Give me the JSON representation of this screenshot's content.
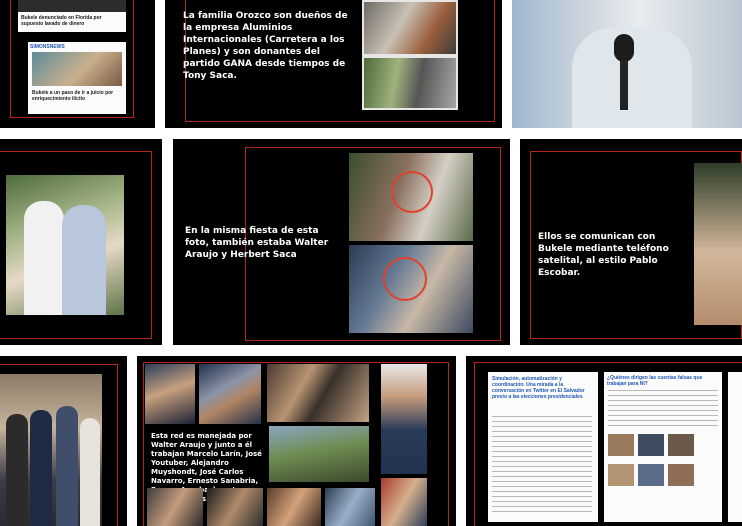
{
  "colors": {
    "frame_red": "#b3261e",
    "tile_bg": "#000000",
    "ring_red": "#e0402c",
    "news_blue": "#1e58b6"
  },
  "tile1": {
    "headline_top": "Bukele denunciado en Florida por supuesto lavado de dinero",
    "brand": "SIMONSNEWS",
    "headline_bottom": "Bukele a un paso de ir a juicio por enriquecimiento ilícito"
  },
  "tile2": {
    "caption": "La familia Orozco son dueños de la empresa Aluminios Internacionales (Carretera a los Planes) y son donantes del partido GANA desde tiempos de Tony Saca."
  },
  "tile5": {
    "caption": "En la misma fiesta de esta foto, también estaba Walter Araujo y Herbert Saca"
  },
  "tile6": {
    "caption": "Ellos se comunican con Bukele mediante teléfono satelital, al estilo Pablo Escobar."
  },
  "tile8": {
    "caption": "Esta red es manejada por Walter Araujo y junto a él trabajan Marcelo Larín, José Youtuber, Alejandro Muyshondt, José Carlos Navarro, Ernesto Sanabria, Romeo Auerbach y otros como vértices."
  },
  "tile9": {
    "article_title": "Simulación, automatización y coordinación. Una mirada a la conversación en Twitter en El Salvador previo a las elecciones presidenciales",
    "right_title": "¿Quiénes dirigen las cuentas falsas que trabajan para NI?"
  }
}
